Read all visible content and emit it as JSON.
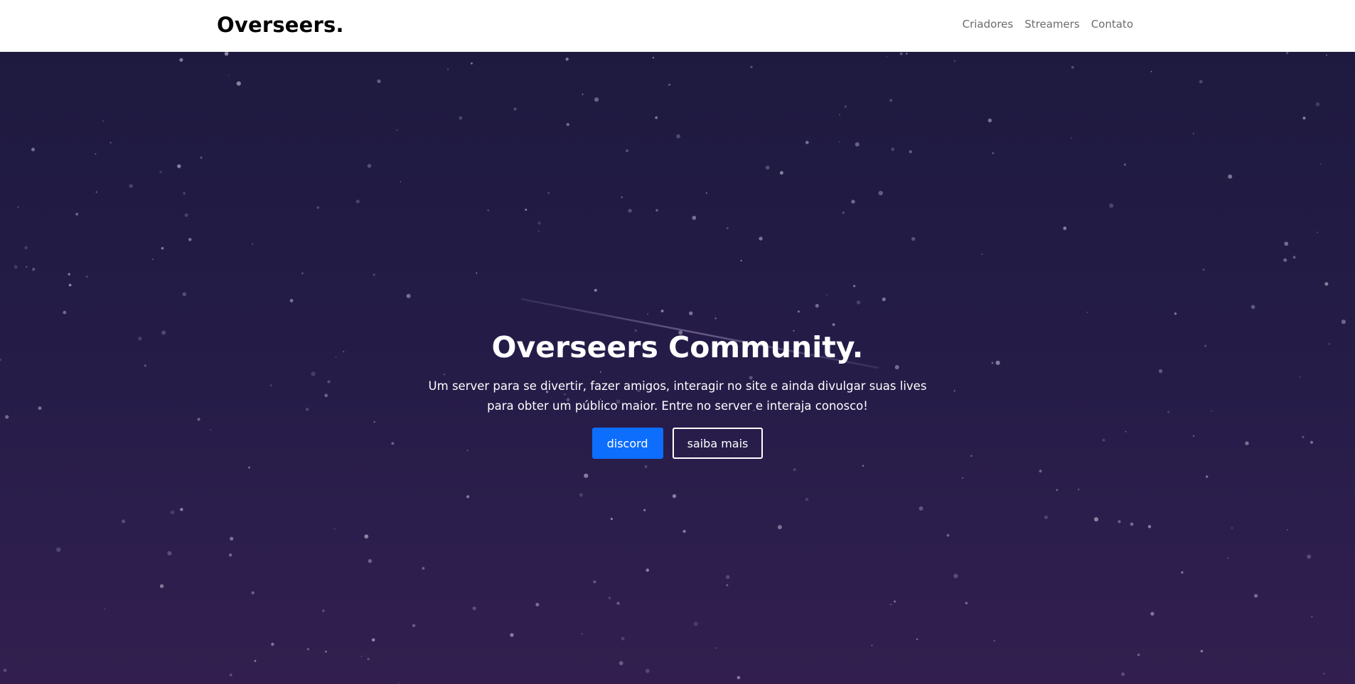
{
  "navbar": {
    "brand": "Overseers.",
    "links": [
      "Criadores",
      "Streamers",
      "Contato"
    ]
  },
  "hero": {
    "title": "Overseers Community.",
    "text": "Um server para se divertir, fazer amigos, interagir no site e ainda divulgar suas lives para obter um público maior. Entre no server e interaja conosco!",
    "buttons": {
      "primary": "discord",
      "secondary": "saiba mais"
    }
  },
  "colors": {
    "navbar_bg": "#ffffff",
    "brand_text": "#000000",
    "nav_link": "#6c6c6c",
    "hero_bg_top": "#1e1a3f",
    "hero_bg_bottom": "#321f4f",
    "primary_button": "#0d6efd",
    "hero_text": "#ffffff"
  }
}
